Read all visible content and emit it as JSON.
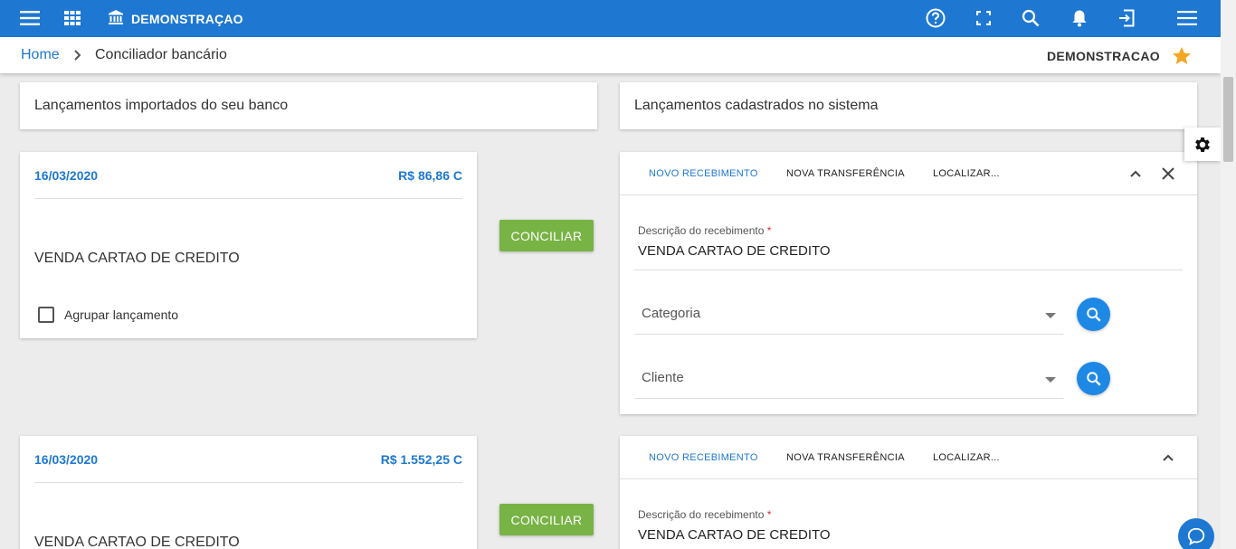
{
  "topbar": {
    "company": "DEMONSTRAÇAO",
    "icons": [
      "menu-icon",
      "apps-grid-icon",
      "bank-icon",
      "help-icon",
      "fullscreen-icon",
      "search-icon",
      "bell-icon",
      "exit-icon",
      "hamburger-icon"
    ]
  },
  "breadcrumb": {
    "home": "Home",
    "current": "Conciliador bancário",
    "company": "DEMONSTRACAO"
  },
  "sections": {
    "left_title": "Lançamentos importados do seu banco",
    "right_title": "Lançamentos cadastrados no sistema"
  },
  "entries": [
    {
      "date": "16/03/2020",
      "amount": "R$ 86,86 C",
      "description": "VENDA CARTAO DE CREDITO",
      "group_label": "Agrupar lançamento",
      "conciliar_label": "CONCILIAR",
      "tabs": [
        "NOVO RECEBIMENTO",
        "NOVA TRANSFERÊNCIA",
        "LOCALIZAR..."
      ],
      "form": {
        "desc_label": "Descrição do recebimento",
        "required_mark": "*",
        "desc_value": "VENDA CARTAO DE CREDITO",
        "category_placeholder": "Categoria",
        "client_placeholder": "Cliente"
      }
    },
    {
      "date": "16/03/2020",
      "amount": "R$ 1.552,25 C",
      "description": "VENDA CARTAO DE CREDITO",
      "conciliar_label": "CONCILIAR",
      "tabs": [
        "NOVO RECEBIMENTO",
        "NOVA TRANSFERÊNCIA",
        "LOCALIZAR..."
      ],
      "form": {
        "desc_label": "Descrição do recebimento",
        "required_mark": "*",
        "desc_value": "VENDA CARTAO DE CREDITO"
      }
    }
  ],
  "colors": {
    "primary": "#1e78d2",
    "success": "#78b345",
    "star": "#f5a623",
    "background": "#ececec"
  }
}
